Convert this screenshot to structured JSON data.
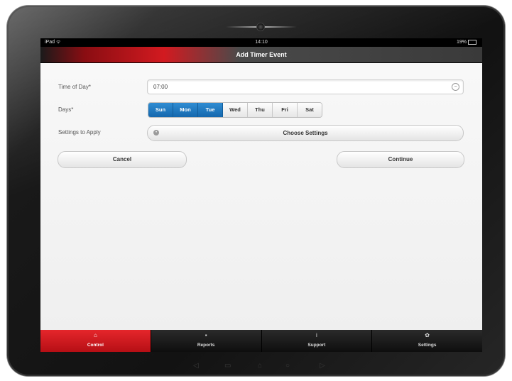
{
  "status_bar": {
    "carrier": "iPad ᯤ",
    "time": "14:10",
    "battery": "19%"
  },
  "title": "Add Timer Event",
  "form": {
    "time_label": "Time of Day*",
    "time_value": "07:00",
    "days_label": "Days*",
    "days": [
      {
        "label": "Sun",
        "selected": true
      },
      {
        "label": "Mon",
        "selected": true
      },
      {
        "label": "Tue",
        "selected": true
      },
      {
        "label": "Wed",
        "selected": false
      },
      {
        "label": "Thu",
        "selected": false
      },
      {
        "label": "Fri",
        "selected": false
      },
      {
        "label": "Sat",
        "selected": false
      }
    ],
    "settings_label": "Settings to Apply",
    "choose_settings": "Choose Settings",
    "cancel": "Cancel",
    "continue": "Continue"
  },
  "tabs": [
    {
      "label": "Control",
      "icon": "home-icon",
      "active": true
    },
    {
      "label": "Reports",
      "icon": "reports-icon",
      "active": false
    },
    {
      "label": "Support",
      "icon": "info-icon",
      "active": false
    },
    {
      "label": "Settings",
      "icon": "gear-icon",
      "active": false
    }
  ],
  "colors": {
    "accent_red": "#d21a20",
    "selected_blue": "#1f79c0"
  }
}
